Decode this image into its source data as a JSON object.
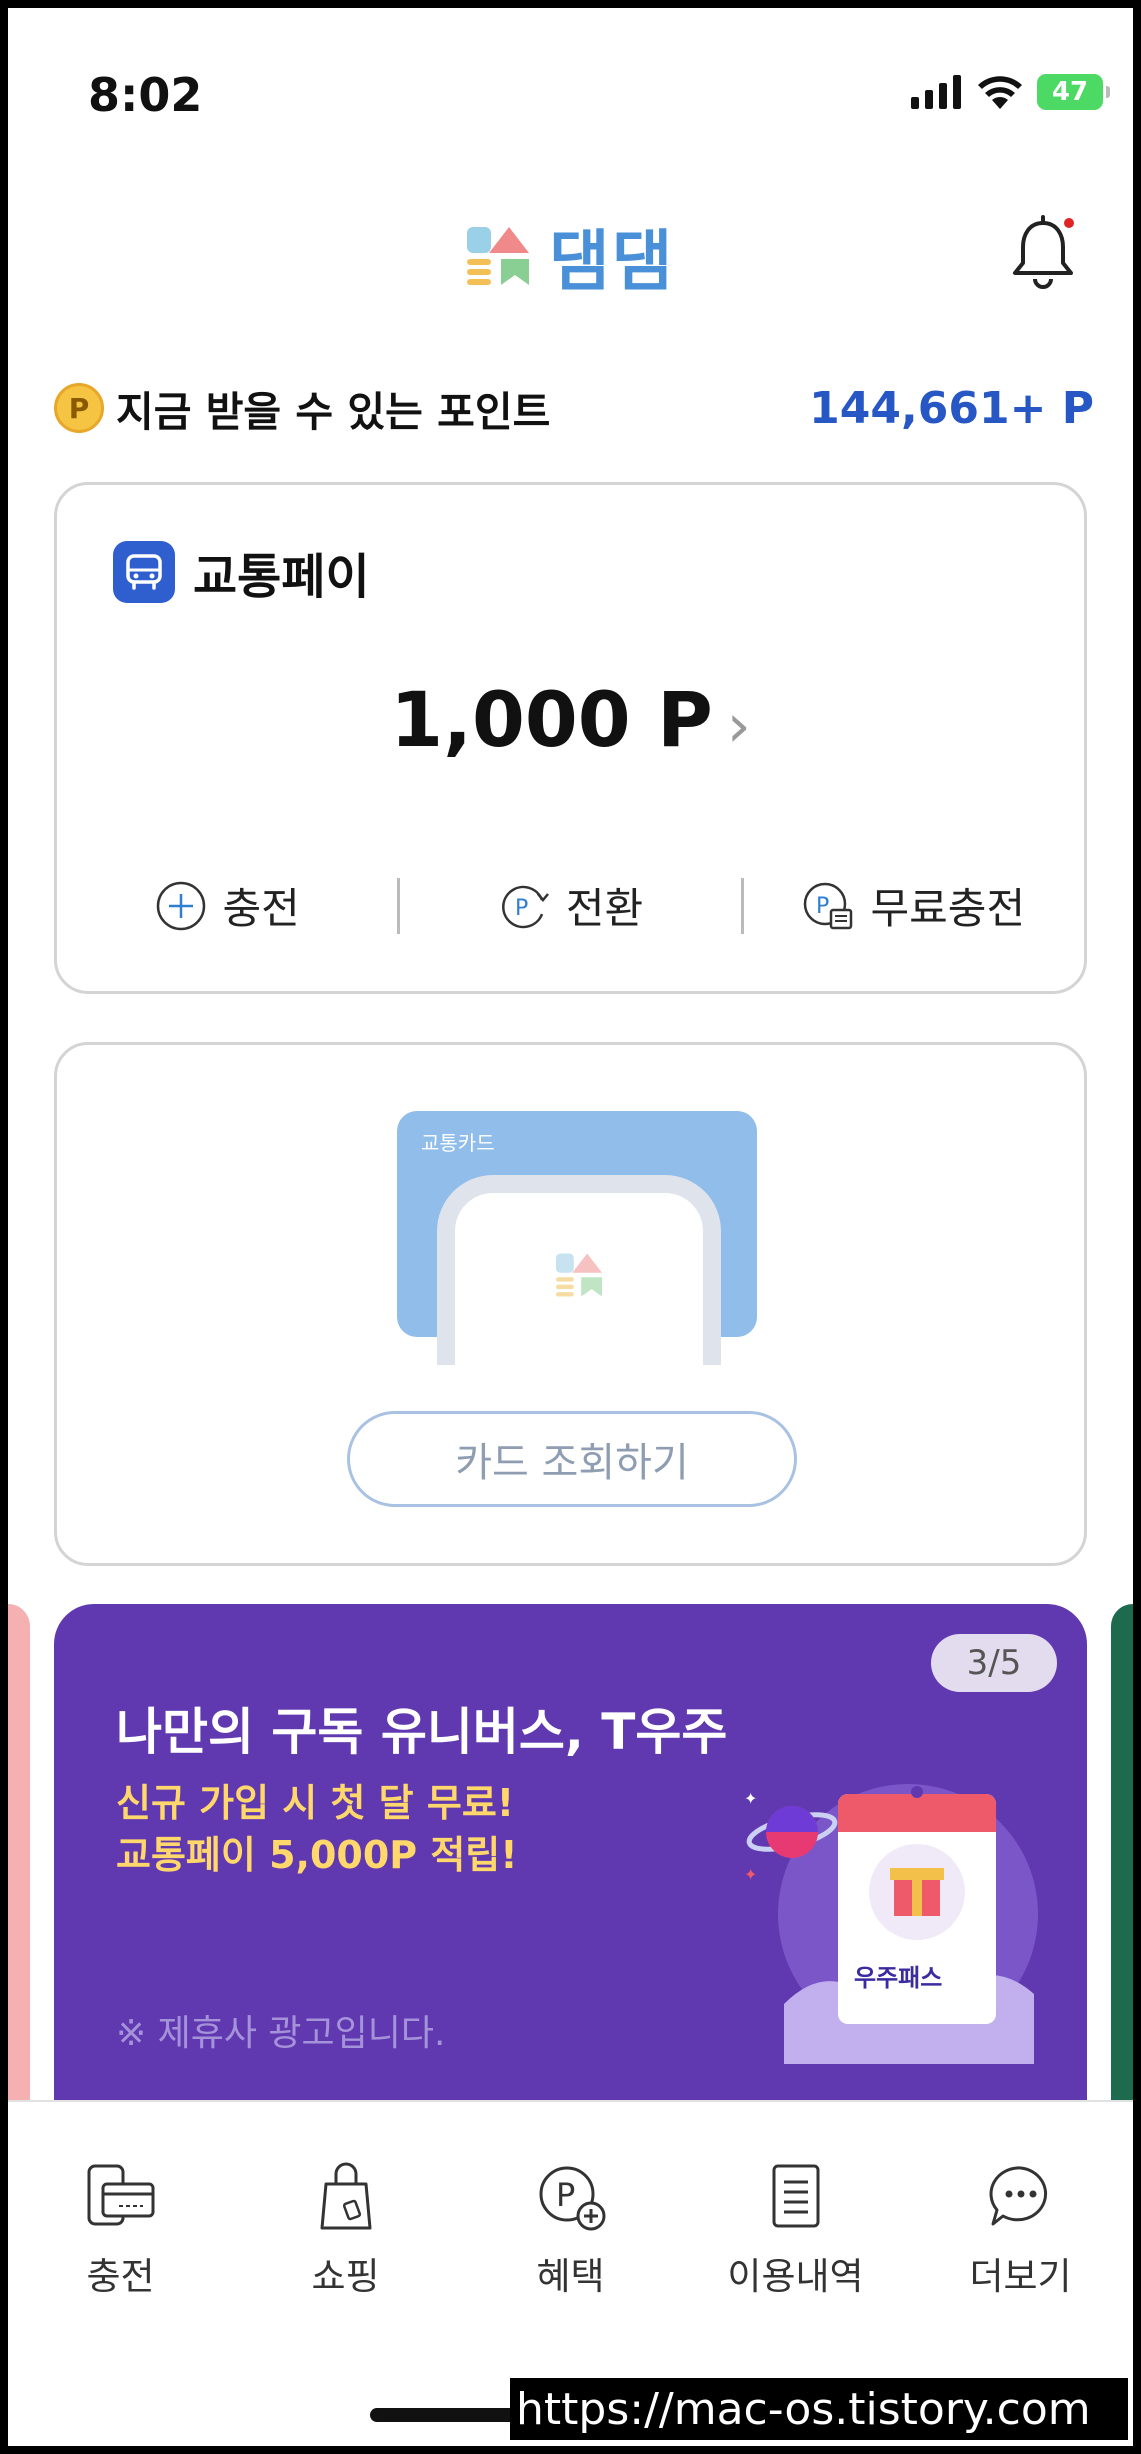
{
  "status_bar": {
    "time": "8:02",
    "battery": "47"
  },
  "header": {
    "logo_text": "댐댐"
  },
  "points": {
    "coin_label": "P",
    "label": "지금 받을 수 있는 포인트",
    "value": "144,661+ P"
  },
  "pay_card": {
    "title": "교통페이",
    "amount": "1,000 P",
    "actions": [
      {
        "label": "충전",
        "icon": "plus-circle-icon"
      },
      {
        "label": "전환",
        "icon": "point-convert-icon"
      },
      {
        "label": "무료충전",
        "icon": "point-free-charge-icon"
      }
    ]
  },
  "transit_card": {
    "card_label": "교통카드",
    "button_label": "카드 조회하기"
  },
  "banner": {
    "page_indicator": "3/5",
    "title": "나만의 구독 유니버스, T우주",
    "subtitle_1": "신규 가입 시 첫 달 무료!",
    "subtitle_2": "교통페이 5,000P 적립!",
    "note": "※ 제휴사 광고입니다.",
    "art_label": "우주패스",
    "colors": {
      "background": "#6039b1",
      "highlight": "#ffd76b"
    }
  },
  "bottom_nav": [
    {
      "label": "충전",
      "icon": "charge-device-icon"
    },
    {
      "label": "쇼핑",
      "icon": "shopping-bag-icon"
    },
    {
      "label": "혜택",
      "icon": "benefit-point-icon"
    },
    {
      "label": "이용내역",
      "icon": "history-document-icon"
    },
    {
      "label": "더보기",
      "icon": "more-chat-icon"
    }
  ],
  "watermark": "https://mac-os.tistory.com",
  "colors": {
    "accent": "#2657c4",
    "logo": "#4a90d9",
    "notification_dot": "#e02424"
  }
}
